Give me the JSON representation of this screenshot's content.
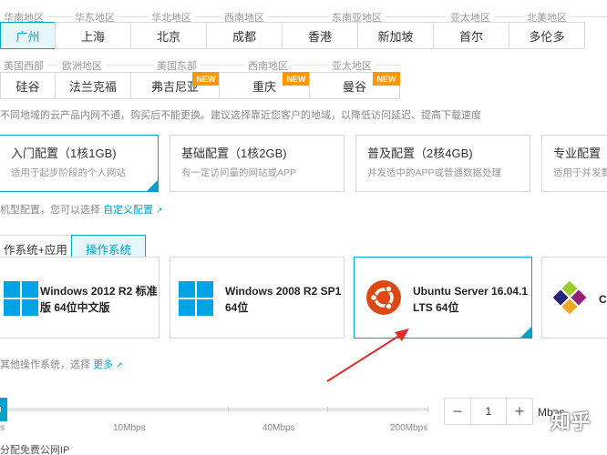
{
  "regions": {
    "row1_groups": [
      "华南地区",
      "华东地区",
      "华北地区",
      "西南地区",
      "东南亚地区",
      "亚太地区",
      "北美地区"
    ],
    "row1": [
      "广州",
      "上海",
      "北京",
      "成都",
      "香港",
      "新加坡",
      "首尔",
      "多伦多"
    ],
    "row2_groups": [
      "美国西部",
      "欧洲地区",
      "美国东部",
      "西南地区",
      "亚太地区"
    ],
    "row2": [
      "硅谷",
      "法兰克福",
      "弗吉尼亚",
      "重庆",
      "曼谷"
    ],
    "new_badge": "NEW",
    "note": "不同地域的云产品内网不通，购买后不能更换。建议选择靠近您客户的地域，以降低访问延迟、提高下载速度"
  },
  "configs": {
    "cards": [
      {
        "title": "入门配置（1核1GB)",
        "desc": "适用于起步阶段的个人网站"
      },
      {
        "title": "基础配置（1核2GB)",
        "desc": "有一定访问量的网站或APP"
      },
      {
        "title": "普及配置（2核4GB)",
        "desc": "并发适中的APP或普通数据处理"
      },
      {
        "title": "专业配置",
        "desc": "适用于并发要"
      }
    ],
    "note_prefix": "机型配置，您可以选择",
    "custom_link": "自定义配置"
  },
  "os_tabs": [
    "作系统+应用",
    "操作系统"
  ],
  "os_cards": {
    "win2012_line1": "Windows 2012 R2 标准",
    "win2012_line2": "版 64位中文版",
    "win2008_line1": "Windows 2008 R2 SP1",
    "win2008_line2": "64位",
    "ubuntu_line1": "Ubuntu Server 16.04.1",
    "ubuntu_line2": "LTS 64位",
    "centos_line1": "C"
  },
  "os_note": {
    "prefix": "其他操作系统，选择",
    "more_link": "更多"
  },
  "bandwidth": {
    "ticks": [
      "s",
      "10Mbps",
      "40Mbps",
      "200Mbps"
    ],
    "value": "1",
    "minus": "−",
    "plus": "+",
    "unit": "Mbps",
    "ip_note": "分配免费公网IP"
  },
  "watermark": "知乎",
  "colors": {
    "accent": "#00a2ca",
    "badge": "#ff9800",
    "arrow": "#e02b2b",
    "ubuntu": "#dd4814"
  }
}
